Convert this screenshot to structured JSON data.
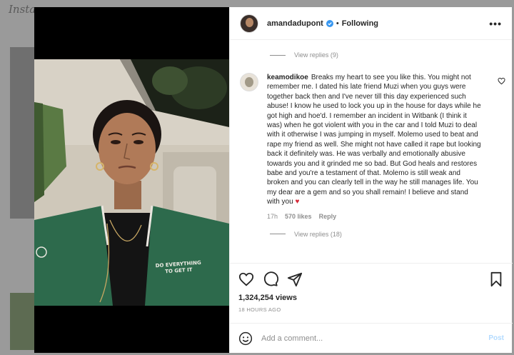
{
  "background": {
    "logo_text": "Instagram"
  },
  "post": {
    "username": "amandadupont",
    "following_label": "Following",
    "separator": "•",
    "video_jacket_text_line1": "DO EVERYTHING",
    "video_jacket_text_line2": "TO GET IT"
  },
  "comments": {
    "view_replies_top": "View replies (9)",
    "items": [
      {
        "username": "keamodikoe",
        "text": "Breaks my heart to see you like this. You might not remember me. I dated his late friend Muzi when you guys were together back then and I've never till this day experienced such abuse! I know he used to lock you up in the house for days while he got high and hoe'd. I remember an incident in Witbank (I think it was) when he got violent with you in the car and I told Muzi to deal with it otherwise I was jumping in myself. Molemo used to beat and rape my friend as well. She might not have called it rape but looking back it definitely was. He was verbally and emotionally abusive towards you and it grinded me so bad. But God heals and restores babe and you're a testament of that. Molemo is still weak and broken and you can clearly tell in the way he still manages life. You my dear are a gem and so you shall remain! I believe and stand with you",
        "emoji": "♥",
        "age": "17h",
        "likes": "570 likes",
        "reply_label": "Reply"
      }
    ],
    "view_replies_bottom": "View replies (18)"
  },
  "actions": {
    "views": "1,324,254 views",
    "time": "18 HOURS AGO"
  },
  "add_comment": {
    "placeholder": "Add a comment...",
    "post_label": "Post"
  },
  "colors": {
    "verified_blue": "#3897f0",
    "heart_red": "#d62938",
    "jacket_green": "#2d6a4c",
    "post_disabled": "#b3dbff"
  }
}
